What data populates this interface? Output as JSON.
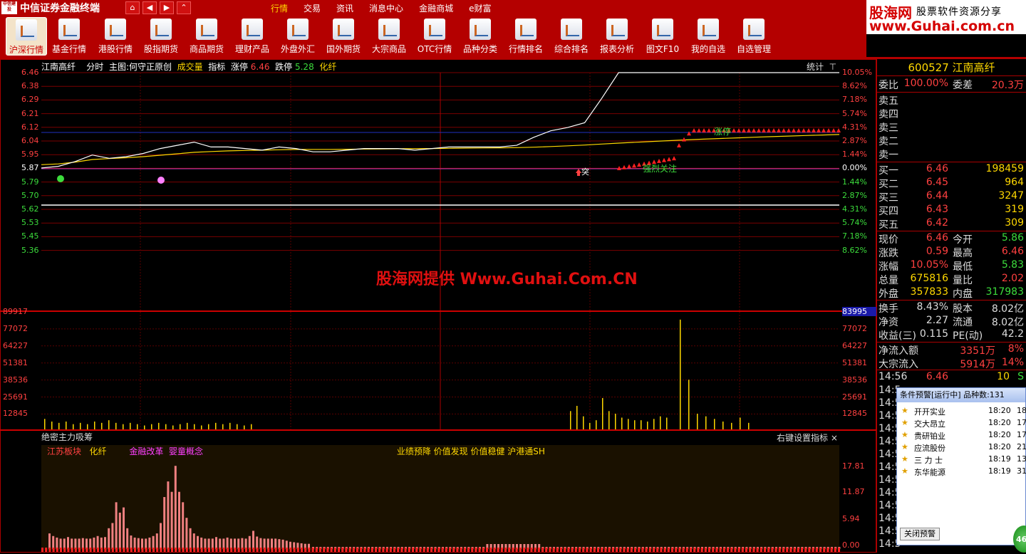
{
  "titlebar": {
    "logo_text": "中信建投",
    "app_title": "中信证券金融终端",
    "nav": [
      "⌂",
      "◀",
      "▶",
      "⌃"
    ],
    "menu": [
      "行情",
      "交易",
      "资讯",
      "消息中心",
      "金融商城",
      "e财富"
    ],
    "active_menu": "行情",
    "brand_name": "股海网",
    "brand_sub": "股票软件资源分享",
    "brand_url": "www.Guhai.com.cn"
  },
  "toolbar": {
    "items": [
      "沪深行情",
      "基金行情",
      "港股行情",
      "股指期货",
      "商品期货",
      "理财产品",
      "外盘外汇",
      "国外期货",
      "大宗商品",
      "OTC行情",
      "品种分类",
      "行情排名",
      "综合排名",
      "报表分析",
      "图文F10",
      "我的自选",
      "自选管理"
    ],
    "active": "沪深行情"
  },
  "chart_header": {
    "stock": "江南高纤",
    "mode": "分时",
    "main_label": "主图:何守正原创",
    "vol_label": "成交量",
    "ind_label": "指标",
    "up_limit_label": "涨停",
    "up_limit": "6.46",
    "down_limit_label": "跌停",
    "down_limit": "5.28",
    "sector": "化纤",
    "stat_btn": "统计",
    "stat_icon": "dropdown-arrow"
  },
  "price_axis": {
    "left": [
      "6.46",
      "6.38",
      "6.29",
      "6.21",
      "6.12",
      "6.04",
      "5.95",
      "5.87",
      "5.79",
      "5.70",
      "5.62",
      "5.53",
      "5.45",
      "5.36"
    ],
    "right": [
      "10.05%",
      "8.62%",
      "7.18%",
      "5.74%",
      "4.31%",
      "2.87%",
      "1.44%",
      "0.00%",
      "1.44%",
      "2.87%",
      "4.31%",
      "5.74%",
      "7.18%",
      "8.62%"
    ]
  },
  "volume_axis": {
    "left": [
      "89917",
      "77072",
      "64227",
      "51381",
      "38536",
      "25691",
      "12845"
    ],
    "right_highlight": "83995",
    "right": [
      "77072",
      "64227",
      "51381",
      "38536",
      "25691",
      "12845"
    ]
  },
  "chart_annotations": {
    "breakout": "突",
    "strong_focus": "强烈关注",
    "limit_up": "涨停"
  },
  "chart_data": {
    "type": "line",
    "title": "",
    "x_label": "",
    "y_label": "",
    "ylim": [
      5.28,
      6.46
    ],
    "prev_close": 5.87,
    "series": [
      {
        "values": [
          5.87,
          5.88,
          5.91,
          5.95,
          5.93,
          5.94,
          5.96,
          5.99,
          6.01,
          6.03,
          6.0,
          6.0,
          5.99,
          5.98,
          6.0,
          5.99,
          5.97,
          5.97,
          5.98,
          5.99,
          5.99,
          5.99,
          5.98,
          5.99,
          6.0,
          6.0,
          6.0,
          6.0,
          6.01,
          6.06,
          6.1,
          6.12,
          6.15,
          6.3,
          6.46,
          6.46,
          6.46,
          6.46,
          6.46,
          6.46,
          6.46,
          6.46,
          6.46,
          6.46,
          6.46,
          6.46,
          6.46,
          6.46
        ]
      }
    ]
  },
  "volume_data": {
    "ylim": [
      0,
      89917
    ],
    "values": [
      8000,
      6000,
      5000,
      6000,
      4000,
      5000,
      4000,
      6000,
      5000,
      7000,
      5000,
      4000,
      5000,
      4000,
      3000,
      4000,
      5000,
      4000,
      3000,
      4000,
      5000,
      4000,
      3000,
      4000,
      5000,
      4000,
      5000,
      4000,
      3000,
      4000,
      14000,
      18000,
      10000,
      5000,
      7000,
      24000,
      14000,
      12000,
      9000,
      8000,
      7000,
      7000,
      6000,
      8000,
      10000,
      9000,
      84000,
      38000,
      12000,
      10000,
      8000,
      6000,
      5000,
      9000,
      5000
    ]
  },
  "indicator": {
    "title": "绝密主力吸筹",
    "right_btn": "右键设置指标",
    "close": "×",
    "sector1": "江苏板块",
    "sector2": "化纤",
    "concept1": "金融改革",
    "concept2": "婴童概念",
    "tags": "业绩预降 价值发现 价值稳健 沪港通SH",
    "axis": [
      "17.81",
      "11.87",
      "5.94",
      "0.00"
    ],
    "values": [
      3,
      2.5,
      2.2,
      2,
      2,
      2.3,
      2,
      2,
      2,
      2.1,
      2,
      2,
      2.2,
      2.5,
      2.2,
      2.3,
      4,
      5,
      9,
      7,
      8,
      4,
      2.6,
      2.2,
      2.1,
      2,
      2,
      2.2,
      2.5,
      3,
      5,
      10,
      13,
      11,
      16,
      11,
      9,
      6,
      4,
      3,
      2.5,
      2.2,
      2,
      2,
      2,
      2.3,
      2,
      2,
      2.2,
      2,
      2,
      2,
      2.1,
      2,
      2.5,
      3.5,
      2.4,
      2.1,
      2,
      2,
      2,
      2,
      1.9,
      1.8,
      1.6,
      1.4,
      1.3,
      1.2,
      1.1,
      1,
      1
    ],
    "ylim": [
      0,
      20
    ]
  },
  "quote": {
    "code_name": "600527 江南高纤",
    "weibi_label": "委比",
    "weibi": "100.00%",
    "weicha_label": "委差",
    "weicha": "20.3万",
    "asks": [
      "卖五",
      "卖四",
      "卖三",
      "卖二",
      "卖一"
    ],
    "bids": [
      {
        "label": "买一",
        "price": "6.46",
        "vol": "198459"
      },
      {
        "label": "买二",
        "price": "6.45",
        "vol": "964"
      },
      {
        "label": "买三",
        "price": "6.44",
        "vol": "3247"
      },
      {
        "label": "买四",
        "price": "6.43",
        "vol": "319"
      },
      {
        "label": "买五",
        "price": "6.42",
        "vol": "309"
      }
    ],
    "stats": [
      {
        "l1": "现价",
        "v1": "6.46",
        "l2": "今开",
        "v2": "5.86",
        "c2": "#3cdc3c"
      },
      {
        "l1": "涨跌",
        "v1": "0.59",
        "l2": "最高",
        "v2": "6.46",
        "c2": "#ff4040"
      },
      {
        "l1": "涨幅",
        "v1": "10.05%",
        "l2": "最低",
        "v2": "5.83",
        "c2": "#3cdc3c"
      },
      {
        "l1": "总量",
        "v1": "675816",
        "l2": "量比",
        "v2": "2.02",
        "c2": "#ff4040"
      },
      {
        "l1": "外盘",
        "v1": "357833",
        "l2": "内盘",
        "v2": "317983",
        "c2": "#3cdc3c"
      }
    ],
    "stats2": [
      {
        "l1": "换手",
        "v1": "8.43%",
        "l2": "股本",
        "v2": "8.02亿"
      },
      {
        "l1": "净资",
        "v1": "2.27",
        "l2": "流通",
        "v2": "8.02亿"
      },
      {
        "l1": "收益(三)",
        "v1": "0.115",
        "l2": "PE(动)",
        "v2": "42.2"
      }
    ],
    "flow": [
      {
        "label": "净流入额",
        "val": "3351万",
        "pct": "8%"
      },
      {
        "label": "大宗流入",
        "val": "5914万",
        "pct": "14%"
      }
    ],
    "tick": {
      "time": "14:56",
      "price": "6.46",
      "vol": "10",
      "side": "S"
    },
    "tick_times": [
      "14:5",
      "14:5",
      "14:5",
      "14:5",
      "14:5",
      "14:5",
      "14:5",
      "14:5",
      "14:5",
      "14:5",
      "14:5",
      "14:5",
      "14:5"
    ]
  },
  "alert": {
    "title": "条件预警[运行中] 品种数:131",
    "items": [
      {
        "name": "开开实业",
        "time": "18:20",
        "n": "18"
      },
      {
        "name": "交大昂立",
        "time": "18:20",
        "n": "17"
      },
      {
        "name": "贵研铂业",
        "time": "18:20",
        "n": "17"
      },
      {
        "name": "应流股份",
        "time": "18:20",
        "n": "21"
      },
      {
        "name": "三 力 士",
        "time": "18:19",
        "n": "13"
      },
      {
        "name": "东华能源",
        "time": "18:19",
        "n": "31"
      }
    ],
    "close_btn": "关闭预警",
    "badge": "46"
  },
  "watermark": "股海网提供 Www.Guhai.Com.CN",
  "colors": {
    "frame": "#b40000",
    "grid": "#8a0000",
    "price_line": "#ffffff",
    "avg_line": "#ffd800",
    "up": "#ff4040",
    "down": "#3cdc3c"
  }
}
